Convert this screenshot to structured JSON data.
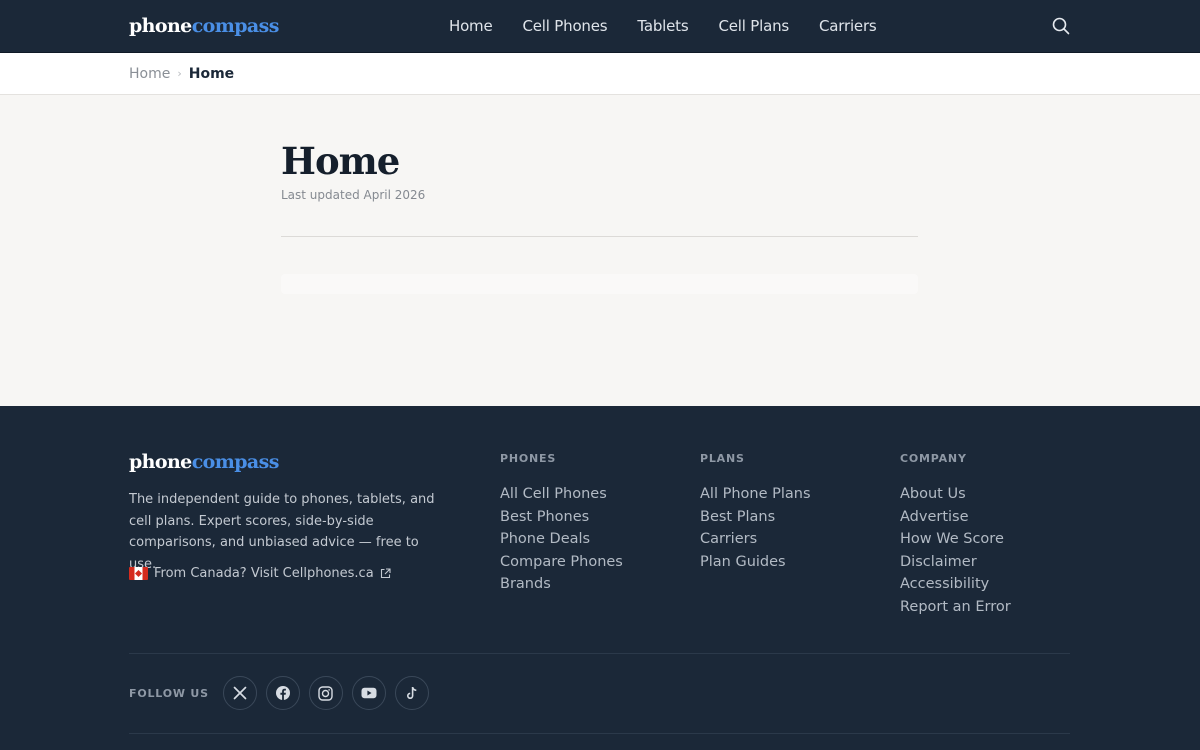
{
  "header": {
    "logo_part1": "phone",
    "logo_part2": "compass",
    "nav": [
      "Home",
      "Cell Phones",
      "Tablets",
      "Cell Plans",
      "Carriers"
    ],
    "search_icon": "search-icon"
  },
  "breadcrumb": {
    "home": "Home",
    "separator": "›",
    "current": "Home"
  },
  "main": {
    "title": "Home",
    "updated": "Last updated April 2026"
  },
  "footer": {
    "logo_part1": "phone",
    "logo_part2": "compass",
    "description": "The independent guide to phones, tablets, and cell plans. Expert scores, side-by-side comparisons, and unbiased advice — free to use.",
    "canada_link": "From Canada? Visit Cellphones.ca",
    "columns": [
      {
        "heading": "PHONES",
        "links": [
          "All Cell Phones",
          "Best Phones",
          "Phone Deals",
          "Compare Phones",
          "Brands"
        ]
      },
      {
        "heading": "PLANS",
        "links": [
          "All Phone Plans",
          "Best Plans",
          "Carriers",
          "Plan Guides"
        ]
      },
      {
        "heading": "COMPANY",
        "links": [
          "About Us",
          "Advertise",
          "How We Score",
          "Disclaimer",
          "Accessibility",
          "Report an Error"
        ]
      }
    ],
    "follow_label": "FOLLOW US",
    "socials": [
      "x-icon",
      "facebook-icon",
      "instagram-icon",
      "youtube-icon",
      "tiktok-icon"
    ]
  },
  "colors": {
    "navy": "#1b2838",
    "accent": "#4a8fe6",
    "page_bg": "#f7f6f4"
  }
}
